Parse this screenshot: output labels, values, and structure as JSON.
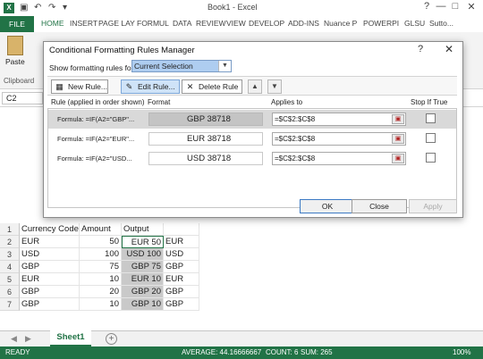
{
  "window": {
    "title": "Book1 - Excel",
    "logo": "X",
    "qat_icons": [
      "save-icon",
      "undo-icon",
      "redo-icon",
      "customize-icon"
    ],
    "controls": [
      "?",
      "—",
      "□",
      "✕"
    ]
  },
  "ribbon_tabs": [
    "FILE",
    "HOME",
    "INSERT",
    "PAGE LAY",
    "FORMUL",
    "DATA",
    "REVIEW",
    "VIEW",
    "DEVELOP",
    "ADD-INS",
    "Nuance P",
    "POWERPI",
    "GLSU",
    "Sutto..."
  ],
  "ribbon": {
    "paste_label": "Paste",
    "group_label": "Clipboard"
  },
  "formula_bar": {
    "name_box": "C2"
  },
  "dialog": {
    "title": "Conditional Formatting Rules Manager",
    "help": "?",
    "close": "✕",
    "show_label": "Show formatting rules for:",
    "show_value": "Current Selection",
    "buttons": {
      "new_rule": "New Rule...",
      "edit_rule": "Edit Rule...",
      "delete_rule": "Delete Rule",
      "ok": "OK",
      "close": "Close",
      "apply": "Apply"
    },
    "headers": {
      "rule": "Rule (applied in order shown)",
      "format": "Format",
      "applies": "Applies to",
      "stop": "Stop If True"
    },
    "rules": [
      {
        "rule": "Formula: =IF(A2=\"GBP\"...",
        "format": "GBP 38718",
        "applies": "=$C$2:$C$8"
      },
      {
        "rule": "Formula: =IF(A2=\"EUR\"...",
        "format": "EUR 38718",
        "applies": "=$C$2:$C$8"
      },
      {
        "rule": "Formula: =IF(A2=\"USD...",
        "format": "USD 38718",
        "applies": "=$C$2:$C$8"
      }
    ]
  },
  "sheet": {
    "rows": [
      {
        "num": "1",
        "a": "Currency Code",
        "b": "Amount",
        "c": "Output",
        "d": ""
      },
      {
        "num": "2",
        "a": "EUR",
        "b": "50",
        "c": "EUR 50",
        "d": "EUR"
      },
      {
        "num": "3",
        "a": "USD",
        "b": "100",
        "c": "USD 100",
        "d": "USD"
      },
      {
        "num": "4",
        "a": "GBP",
        "b": "75",
        "c": "GBP 75",
        "d": "GBP"
      },
      {
        "num": "5",
        "a": "EUR",
        "b": "10",
        "c": "EUR 10",
        "d": "EUR"
      },
      {
        "num": "6",
        "a": "GBP",
        "b": "20",
        "c": "GBP 20",
        "d": "GBP"
      },
      {
        "num": "7",
        "a": "GBP",
        "b": "10",
        "c": "GBP 10",
        "d": "GBP"
      }
    ],
    "tab": "Sheet1",
    "nav": [
      "◀",
      "▶"
    ],
    "add": "+"
  },
  "status": {
    "ready": "READY",
    "average": "AVERAGE: 44.16666667",
    "count": "COUNT: 6",
    "sum": "SUM: 265",
    "zoom": "100%"
  },
  "colors": {
    "accent": "#217346",
    "selection": "#aecdf0"
  }
}
